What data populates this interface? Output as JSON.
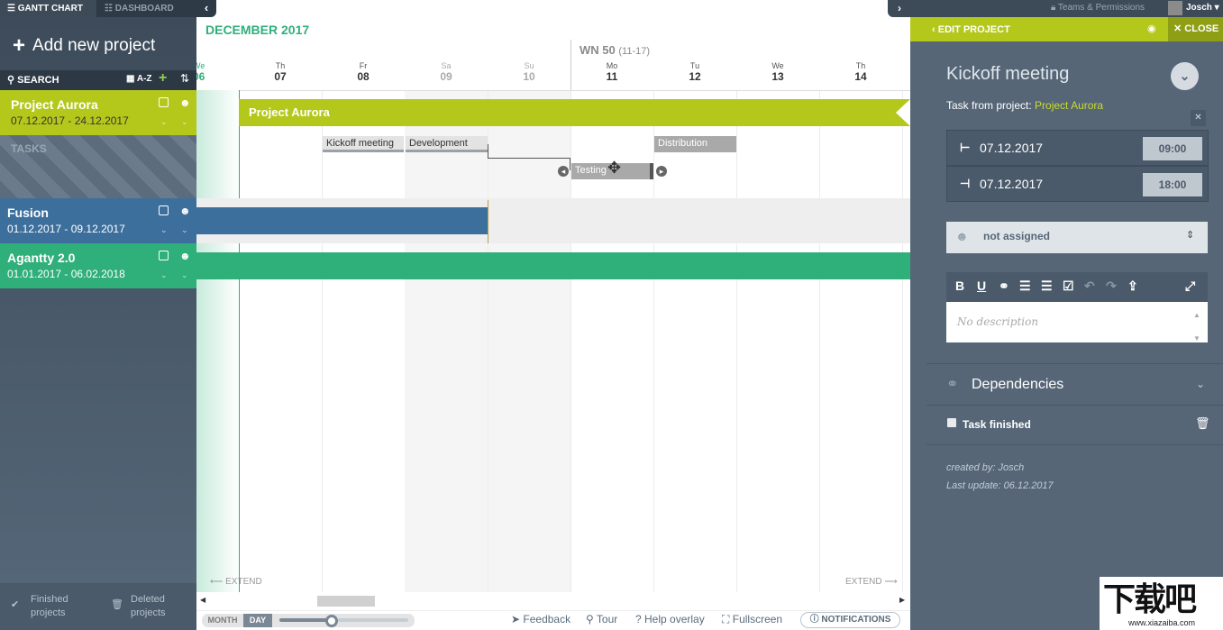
{
  "tabs": {
    "gantt": "GANTT CHART",
    "dashboard": "DASHBOARD"
  },
  "sidebar": {
    "add_project": "Add new project",
    "search": "SEARCH",
    "sort": "A-Z",
    "projects": [
      {
        "name": "Project Aurora",
        "dates": "07.12.2017 - 24.12.2017",
        "color": "#b4c81c"
      },
      {
        "name": "Fusion",
        "dates": "01.12.2017 - 09.12.2017",
        "color": "#3d6f9c"
      },
      {
        "name": "Agantty 2.0",
        "dates": "01.01.2017 - 06.02.2018",
        "color": "#2faf7a"
      }
    ],
    "tasks_label": "TASKS",
    "finished": "Finished projects",
    "deleted": "Deleted projects"
  },
  "timeline": {
    "month": "DECEMBER 2017",
    "week": "WN 50",
    "week_range": "(11-17)",
    "first_day_partial": {
      "name": "We",
      "date": "06"
    },
    "days": [
      {
        "name": "Th",
        "date": "07",
        "weekend": false
      },
      {
        "name": "Fr",
        "date": "08",
        "weekend": false
      },
      {
        "name": "Sa",
        "date": "09",
        "weekend": true
      },
      {
        "name": "Su",
        "date": "10",
        "weekend": true
      },
      {
        "name": "Mo",
        "date": "11",
        "weekend": false
      },
      {
        "name": "Tu",
        "date": "12",
        "weekend": false
      },
      {
        "name": "We",
        "date": "13",
        "weekend": false
      },
      {
        "name": "Th",
        "date": "14",
        "weekend": false
      }
    ],
    "project_bar": "Project Aurora",
    "tasks": [
      "Kickoff meeting",
      "Development",
      "Testing",
      "Distribution"
    ],
    "extend": "EXTEND"
  },
  "bottom": {
    "month": "MONTH",
    "day": "DAY",
    "feedback": "Feedback",
    "tour": "Tour",
    "help": "Help overlay",
    "fullscreen": "Fullscreen",
    "notifications": "NOTIFICATIONS",
    "zoom_level": 0.35
  },
  "header_right": {
    "teams": "Teams & Permissions",
    "user": "Josch"
  },
  "panel": {
    "edit": "EDIT PROJECT",
    "close": "CLOSE",
    "task_title": "Kickoff meeting",
    "from_prefix": "Task from project:",
    "from_project": "Project Aurora",
    "start_date": "07.12.2017",
    "start_time": "09:00",
    "end_date": "07.12.2017",
    "end_time": "18:00",
    "assignee": "not assigned",
    "description_placeholder": "No description",
    "dependencies": "Dependencies",
    "task_finished": "Task finished",
    "created_by": "created by: Josch",
    "last_update": "Last update: 06.12.2017"
  },
  "watermark": {
    "logo": "下载吧",
    "url": "www.xiazaiba.com"
  }
}
